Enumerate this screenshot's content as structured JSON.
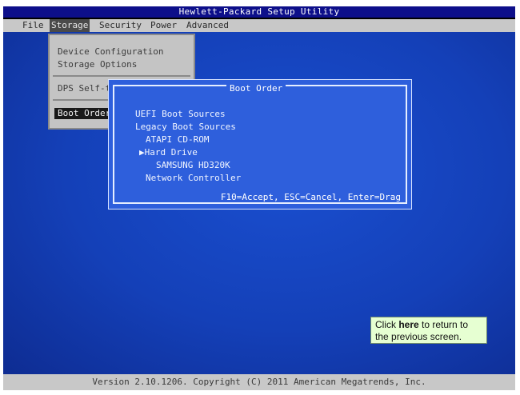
{
  "title_bar": "Hewlett-Packard Setup Utility",
  "menu": {
    "items": [
      {
        "label": "File"
      },
      {
        "label": "Storage"
      },
      {
        "label": "Security"
      },
      {
        "label": "Power"
      },
      {
        "label": "Advanced"
      }
    ],
    "selected": "Storage"
  },
  "storage_menu": {
    "items": [
      {
        "label": "Device Configuration"
      },
      {
        "label": "Storage Options"
      },
      {
        "label": "DPS Self-t"
      },
      {
        "label": "Boot Order"
      }
    ],
    "active": "Boot Order"
  },
  "boot_order": {
    "title": "Boot Order",
    "uefi_label": "UEFI Boot Sources",
    "legacy_label": "Legacy Boot Sources",
    "atapi": "ATAPI CD-ROM",
    "hard_drive_marker": "▶",
    "hard_drive": "Hard Drive",
    "samsung": "SAMSUNG HD320K",
    "network": "Network Controller",
    "footer": "F10=Accept, ESC=Cancel, Enter=Drag"
  },
  "status_bar": "Version 2.10.1206. Copyright (C) 2011 American Megatrends, Inc.",
  "help_box": {
    "prefix": "Click ",
    "link": "here",
    "suffix": " to return to the previous screen."
  },
  "colors": {
    "title_bar_bg": "#0d0f8a",
    "desktop_bg": "#1440b8",
    "dialog_bg": "#2e5fdc",
    "menu_bg": "#c8c8c8",
    "help_bg": "#e6ffd2"
  }
}
